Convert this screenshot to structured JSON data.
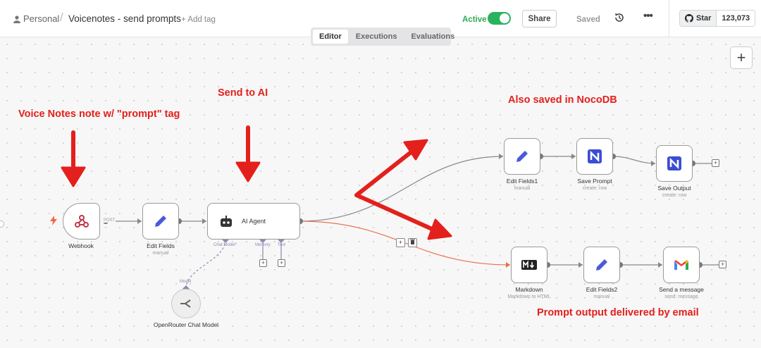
{
  "breadcrumb": {
    "workspace": "Personal",
    "workflow_name": "Voicenotes - send prompts",
    "add_tag": "+ Add tag"
  },
  "status": {
    "active_label": "Active",
    "active": true
  },
  "toolbar": {
    "share": "Share",
    "saved": "Saved"
  },
  "github": {
    "star": "Star",
    "count": "123,073"
  },
  "tabs": [
    {
      "label": "Editor",
      "selected": true
    },
    {
      "label": "Executions",
      "selected": false
    },
    {
      "label": "Evaluations",
      "selected": false
    }
  ],
  "nodes": {
    "webhook": {
      "label": "Webhook",
      "method": "POST"
    },
    "edit_fields": {
      "label": "Edit Fields",
      "subtitle": "manual"
    },
    "ai_agent": {
      "label": "AI Agent",
      "chat_model": "Chat Model*",
      "memory": "Memory",
      "tool": "Tool"
    },
    "openrouter": {
      "label": "OpenRouter Chat Model",
      "port": "Model"
    },
    "edit_fields1": {
      "label": "Edit Fields1",
      "subtitle": "manual"
    },
    "save_prompt": {
      "label": "Save Prompt",
      "subtitle": "create: row"
    },
    "save_output": {
      "label": "Save Output",
      "subtitle": "create: row"
    },
    "markdown": {
      "label": "Markdown",
      "subtitle": "Markdown to HTML"
    },
    "edit_fields2": {
      "label": "Edit Fields2",
      "subtitle": "manual"
    },
    "send_message": {
      "label": "Send a message",
      "subtitle": "send: message"
    }
  },
  "annotations": {
    "voice_notes": "Voice Notes note w/ \"prompt\" tag",
    "send_to_ai": "Send to AI",
    "also_saved": "Also saved in NocoDB",
    "prompt_output": "Prompt output delivered by email"
  },
  "colors": {
    "annotation": "#e4201c",
    "active": "#29b35d",
    "error_edge": "#e8704f"
  }
}
